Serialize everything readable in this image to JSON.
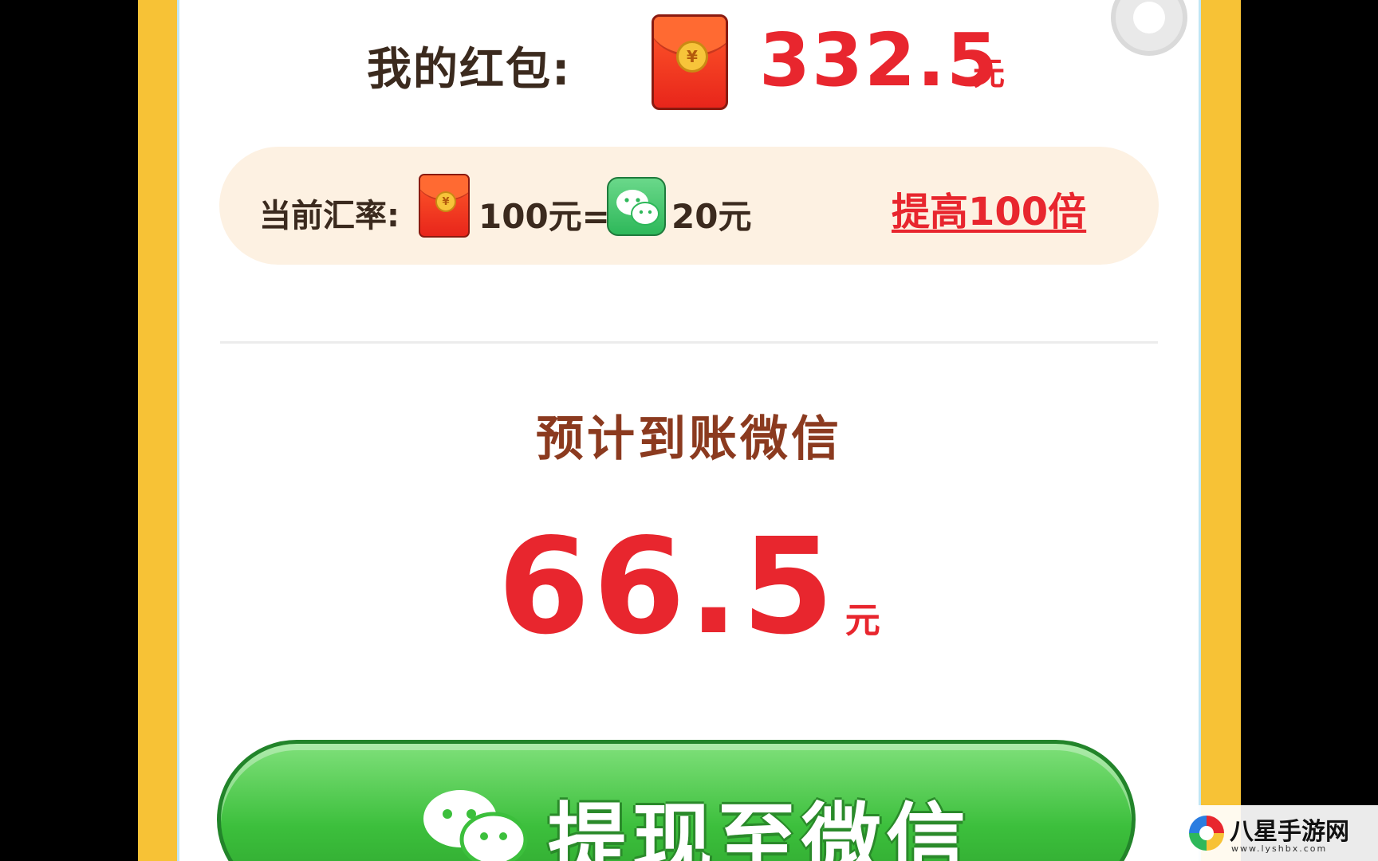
{
  "balance": {
    "label": "我的红包:",
    "value": "332.5",
    "unit": "元"
  },
  "exchange_rate": {
    "label": "当前汇率:",
    "left_amount": "100元=",
    "right_amount": "20元",
    "boost_link": "提高100倍"
  },
  "expected": {
    "label": "预计到账微信",
    "value": "66.5",
    "unit": "元"
  },
  "withdraw_button": {
    "label": "提现至微信"
  },
  "icons": {
    "red_packet": "red-packet-icon",
    "wechat": "wechat-icon",
    "close": "close-circle-icon"
  },
  "colors": {
    "accent_red": "#e8262e",
    "frame_yellow": "#f7c236",
    "button_green": "#3cbf3c",
    "pill_bg": "#fdf1e2"
  },
  "watermark": {
    "name": "八星手游网",
    "url": "www.lyshbx.com"
  }
}
